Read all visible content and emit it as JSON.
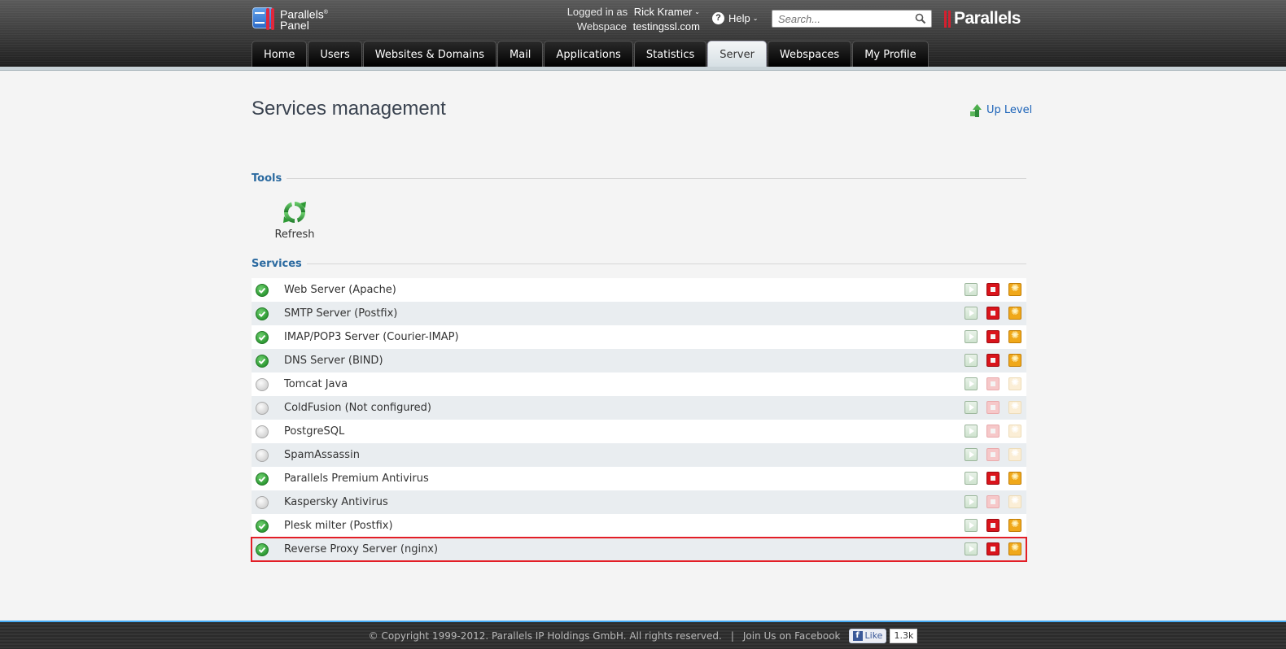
{
  "header": {
    "logo_line1": "Parallels",
    "logo_reg": "®",
    "logo_line2": "Panel",
    "logged_in_label": "Logged in as",
    "user_name": "Rick Kramer",
    "webspace_label": "Webspace",
    "webspace_name": "testingssl.com",
    "help_label": "Help",
    "search_placeholder": "Search...",
    "brand": "Parallels",
    "brand_reg": "®"
  },
  "nav": {
    "tabs": [
      {
        "label": "Home",
        "active": false
      },
      {
        "label": "Users",
        "active": false
      },
      {
        "label": "Websites & Domains",
        "active": false
      },
      {
        "label": "Mail",
        "active": false
      },
      {
        "label": "Applications",
        "active": false
      },
      {
        "label": "Statistics",
        "active": false
      },
      {
        "label": "Server",
        "active": true
      },
      {
        "label": "Webspaces",
        "active": false
      },
      {
        "label": "My Profile",
        "active": false
      }
    ]
  },
  "page": {
    "title": "Services management",
    "up_level_label": "Up Level"
  },
  "tools": {
    "section_label": "Tools",
    "refresh_label": "Refresh"
  },
  "services": {
    "section_label": "Services",
    "items": [
      {
        "name": "Web Server (Apache)",
        "running": true,
        "highlighted": false
      },
      {
        "name": "SMTP Server (Postfix)",
        "running": true,
        "highlighted": false
      },
      {
        "name": "IMAP/POP3 Server (Courier-IMAP)",
        "running": true,
        "highlighted": false
      },
      {
        "name": "DNS Server (BIND)",
        "running": true,
        "highlighted": false
      },
      {
        "name": "Tomcat Java",
        "running": false,
        "highlighted": false
      },
      {
        "name": "ColdFusion (Not configured)",
        "running": false,
        "highlighted": false
      },
      {
        "name": "PostgreSQL",
        "running": false,
        "highlighted": false
      },
      {
        "name": "SpamAssassin",
        "running": false,
        "highlighted": false
      },
      {
        "name": "Parallels Premium Antivirus",
        "running": true,
        "highlighted": false
      },
      {
        "name": "Kaspersky Antivirus",
        "running": false,
        "highlighted": false
      },
      {
        "name": "Plesk milter (Postfix)",
        "running": true,
        "highlighted": false
      },
      {
        "name": "Reverse Proxy Server (nginx)",
        "running": true,
        "highlighted": true
      }
    ]
  },
  "footer": {
    "copyright": "© Copyright 1999-2012. Parallels IP Holdings GmbH. All rights reserved.",
    "separator": "|",
    "facebook_text": "Join Us on Facebook",
    "like_label": "Like",
    "like_count": "1.3k"
  },
  "colors": {
    "accent_blue": "#2b6aa0",
    "link_blue": "#1a62b8",
    "highlight_red": "#e31e26",
    "running_green": "#2e9a34",
    "stop_red": "#d9141b",
    "restart_orange": "#f0a81a"
  }
}
